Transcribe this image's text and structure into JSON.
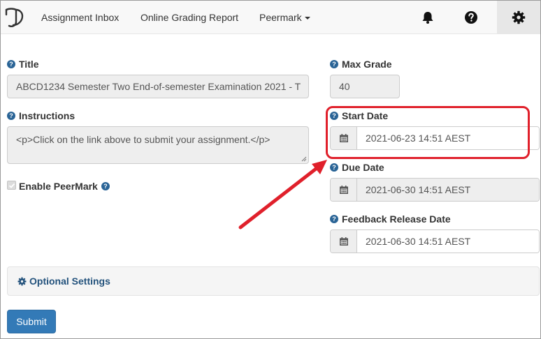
{
  "navbar": {
    "links": {
      "inbox": "Assignment Inbox",
      "report": "Online Grading Report",
      "peermark": "Peermark"
    },
    "icons": [
      "bell-icon",
      "question-circle-icon",
      "gear-icon"
    ],
    "active_icon": "gear-icon",
    "background": "#f8f8f8"
  },
  "form": {
    "title": {
      "label": "Title",
      "value": "ABCD1234 Semester Two End-of-semester Examination 2021 - T"
    },
    "instructions": {
      "label": "Instructions",
      "value": "<p>Click on the link above to submit your assignment.</p>"
    },
    "enable_peermark": {
      "label": "Enable PeerMark",
      "checked": true
    },
    "max_grade": {
      "label": "Max Grade",
      "value": "40"
    },
    "start_date": {
      "label": "Start Date",
      "value": "2021-06-23 14:51 AEST"
    },
    "due_date": {
      "label": "Due Date",
      "value": "2021-06-30 14:51 AEST"
    },
    "feedback_release_date": {
      "label": "Feedback Release Date",
      "value": "2021-06-30 14:51 AEST"
    },
    "optional_settings": {
      "label": "Optional Settings"
    },
    "submit_label": "Submit"
  },
  "colors": {
    "primary": "#337ab7",
    "link": "#23527c",
    "annotation": "#e0202b"
  }
}
